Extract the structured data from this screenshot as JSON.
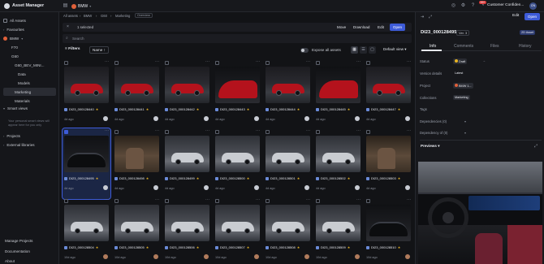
{
  "app": {
    "title": "Asset Manager",
    "brand": "BMW"
  },
  "topbar": {
    "notifications": "99+",
    "user": "Customer Confiden...",
    "user_initials": "CN"
  },
  "sidebar": {
    "all_assets": "All Assets",
    "favourites": "Favourites",
    "brand": "BMW",
    "tree": [
      "F70",
      "G60",
      "G60_BEV_MINI...",
      "Data",
      "Models",
      "Marketing",
      "Materials"
    ],
    "active": "Marketing",
    "smart_views": "Smart views",
    "smart_views_empty": "Your personal smart views will appear here for you only",
    "projects": "Projects",
    "external_libraries": "External libraries",
    "bottom": [
      "Manage Projects",
      "Documentation",
      "About"
    ]
  },
  "breadcrumb": {
    "items": [
      "All assets",
      "BMW",
      "G60",
      "Marketing"
    ],
    "badge": "Overview"
  },
  "selection": {
    "count": "1 selected",
    "actions": [
      "Move",
      "Download",
      "Edit"
    ],
    "open": "Open"
  },
  "search": {
    "placeholder": "Search"
  },
  "filters": {
    "filters_label": "Filters",
    "sort_label": "Name",
    "expose_label": "Expose all assets",
    "view_label": "Default view"
  },
  "assets": [
    {
      "name": "DI23_000128440",
      "date": "4d ago",
      "thumb": "red-exterior",
      "avatar": "user"
    },
    {
      "name": "DI23_000128441",
      "date": "4d ago",
      "thumb": "red-exterior",
      "avatar": "user"
    },
    {
      "name": "DI23_000128442",
      "date": "4d ago",
      "thumb": "red-exterior",
      "avatar": "user"
    },
    {
      "name": "DI23_000128443",
      "date": "4d ago",
      "thumb": "red-detail",
      "avatar": "user"
    },
    {
      "name": "DI23_000128444",
      "date": "4d ago",
      "thumb": "red-exterior",
      "avatar": "user"
    },
    {
      "name": "DI23_000128445",
      "date": "4d ago",
      "thumb": "red-detail",
      "avatar": "user"
    },
    {
      "name": "DI23_000128447",
      "date": "4d ago",
      "thumb": "red-exterior",
      "avatar": "user"
    },
    {
      "name": "DI23_000128495",
      "date": "4d ago",
      "thumb": "interior-wheel",
      "avatar": "user",
      "selected": true
    },
    {
      "name": "DI23_000128498",
      "date": "4d ago",
      "thumb": "interior-seat",
      "avatar": "user"
    },
    {
      "name": "DI23_000128499",
      "date": "4d ago",
      "thumb": "silver-exterior",
      "avatar": "user"
    },
    {
      "name": "DI23_000128500",
      "date": "4d ago",
      "thumb": "silver-exterior",
      "avatar": "user"
    },
    {
      "name": "DI23_000128501",
      "date": "4d ago",
      "thumb": "silver-exterior",
      "avatar": "user"
    },
    {
      "name": "DI23_000128502",
      "date": "4d ago",
      "thumb": "silver-exterior",
      "avatar": "user"
    },
    {
      "name": "DI23_000128503",
      "date": "4d ago",
      "thumb": "interior-seat",
      "avatar": "user"
    },
    {
      "name": "DI23_000128504",
      "date": "10d ago",
      "thumb": "silver-exterior",
      "avatar": "face"
    },
    {
      "name": "DI23_000128505",
      "date": "10d ago",
      "thumb": "silver-exterior",
      "avatar": "face"
    },
    {
      "name": "DI23_000128506",
      "date": "10d ago",
      "thumb": "silver-exterior",
      "avatar": "face"
    },
    {
      "name": "DI23_000128507",
      "date": "10d ago",
      "thumb": "silver-exterior",
      "avatar": "face"
    },
    {
      "name": "DI23_000128508",
      "date": "10d ago",
      "thumb": "silver-exterior",
      "avatar": "face"
    },
    {
      "name": "DI23_000128509",
      "date": "10d ago",
      "thumb": "silver-exterior",
      "avatar": "face"
    },
    {
      "name": "DI23_000128510",
      "date": "10d ago",
      "thumb": "interior-wheel",
      "avatar": "face"
    }
  ],
  "panel": {
    "title": "DI23_000128495",
    "version": "Ver. 3",
    "type": "2D Asset",
    "edit": "Edit",
    "open": "Open",
    "tabs": [
      "Info",
      "Comments",
      "Files",
      "History"
    ],
    "active_tab": "Info",
    "fields": {
      "status_label": "Status",
      "status_value": "Draft",
      "version_label": "Version details",
      "version_value": "Latest",
      "project_label": "Project",
      "project_value": "BMW 1...",
      "collections_label": "Collections",
      "collections_value": "Marketing",
      "tags_label": "Tags",
      "dependencies_label": "Dependencies (0)",
      "dependency_of_label": "Dependency of (0)"
    },
    "previews_label": "Previews"
  },
  "colors": {
    "accent": "#3d5bd8",
    "brand": "#e0603a",
    "star": "#e8b423",
    "draft": "#e8b423"
  }
}
